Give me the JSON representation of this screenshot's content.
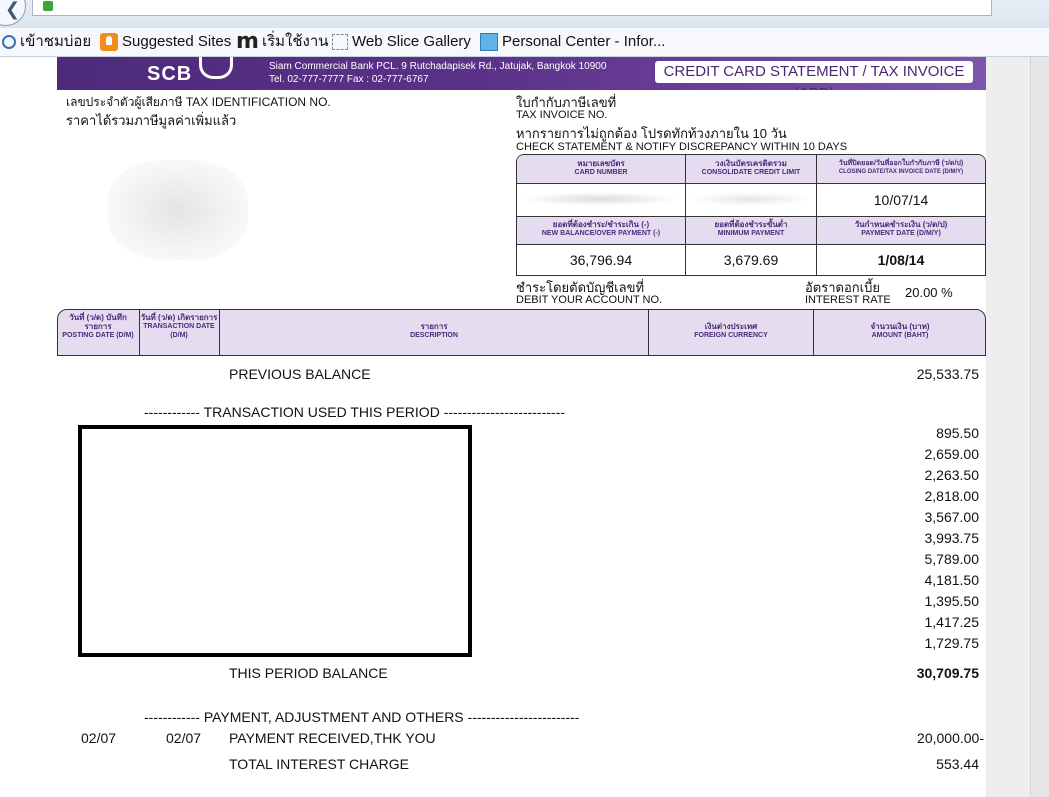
{
  "browser": {
    "favorites": [
      {
        "label": "เข้าชมบ่อย",
        "icon": "search-icon"
      },
      {
        "label": "Suggested Sites",
        "icon": "suggested-sites-icon"
      },
      {
        "label": "เริ่มใช้งาน",
        "icon": "m-icon"
      },
      {
        "label": "Web Slice Gallery",
        "icon": "web-slice-icon"
      },
      {
        "label": "Personal Center - Infor...",
        "icon": "personal-center-icon"
      }
    ]
  },
  "bank": {
    "short_name": "SCB",
    "address_line1": "Siam Commercial Bank PCL. 9 Rutchadapisek Rd., Jatujak, Bangkok 10900",
    "address_line2": "Tel.  02-777-7777   Fax : 02-777-6767",
    "doc_title": "CREDIT CARD STATEMENT / TAX INVOICE (ABB)"
  },
  "left_info": {
    "tax_id_label": "เลขประจำตัวผู้เสียภาษี TAX IDENTIFICATION NO.",
    "vat_note": "ราคาได้รวมภาษีมูลค่าเพิ่มแล้ว"
  },
  "right_info": {
    "tax_invoice_th": "ใบกำกับภาษีเลขที่",
    "tax_invoice_en": "TAX INVOICE NO.",
    "discrepancy_th": "หากรายการไม่ถูกต้อง โปรดทักท้วงภายใน 10 วัน",
    "discrepancy_en": "CHECK STATEMENT & NOTIFY DISCREPANCY WITHIN 10 DAYS"
  },
  "summary": {
    "card_number_th": "หมายเลขบัตร",
    "card_number_en": "CARD NUMBER",
    "credit_limit_th": "วงเงินบัตรเครดิตรวม",
    "credit_limit_en": "CONSOLIDATE CREDIT LIMIT",
    "closing_date_th": "วันที่ปิดยอด/วันที่ออกใบกำกับภาษี (ว/ด/ป)",
    "closing_date_en": "CLOSING DATE/TAX INVOICE DATE (D/M/Y)",
    "closing_date": "10/07/14",
    "new_balance_th": "ยอดที่ต้องชำระ/ชำระเกิน (-)",
    "new_balance_en": "NEW BALANCE/OVER PAYMENT (-)",
    "new_balance": "36,796.94",
    "min_payment_th": "ยอดที่ต้องชำระขั้นต่ำ",
    "min_payment_en": "MINIMUM PAYMENT",
    "min_payment": "3,679.69",
    "payment_date_th": "วันกำหนดชำระเงิน (ว/ด/ป)",
    "payment_date_en": "PAYMENT DATE (D/M/Y)",
    "payment_date": "1/08/14"
  },
  "debit": {
    "label_th": "ชำระโดยตัดบัญชีเลขที่",
    "label_en": "DEBIT YOUR ACCOUNT NO.",
    "interest_th": "อัตราดอกเบี้ย",
    "interest_en": "INTEREST RATE",
    "interest_rate": "20.00 %"
  },
  "columns": {
    "posting_th": "วันที่ (ว/ด) บันทึกรายการ",
    "posting_en": "POSTING DATE (D/M)",
    "trans_th": "วันที่ (ว/ด) เกิดรายการ",
    "trans_en": "TRANSACTION DATE (D/M)",
    "desc_th": "รายการ",
    "desc_en": "DESCRIPTION",
    "fx_th": "เงินต่างประเทศ",
    "fx_en": "FOREIGN CURRENCY",
    "amount_th": "จำนวนเงิน (บาท)",
    "amount_en": "AMOUNT (BAHT)"
  },
  "statement": {
    "previous_balance_label": "PREVIOUS BALANCE",
    "previous_balance": "25,533.75",
    "transactions_header": "------------ TRANSACTION USED THIS PERIOD --------------------------",
    "transaction_amounts": [
      "895.50",
      "2,659.00",
      "2,263.50",
      "2,818.00",
      "3,567.00",
      "3,993.75",
      "5,789.00",
      "4,181.50",
      "1,395.50",
      "1,417.25",
      "1,729.75"
    ],
    "period_balance_label": "THIS PERIOD BALANCE",
    "period_balance": "30,709.75",
    "payments_header": "------------ PAYMENT, ADJUSTMENT AND OTHERS ------------------------",
    "payment_post_date": "02/07",
    "payment_trans_date": "02/07",
    "payment_desc": "PAYMENT RECEIVED,THK YOU",
    "payment_amount": "20,000.00-",
    "interest_label": "TOTAL INTEREST CHARGE",
    "interest_amount": "553.44"
  }
}
